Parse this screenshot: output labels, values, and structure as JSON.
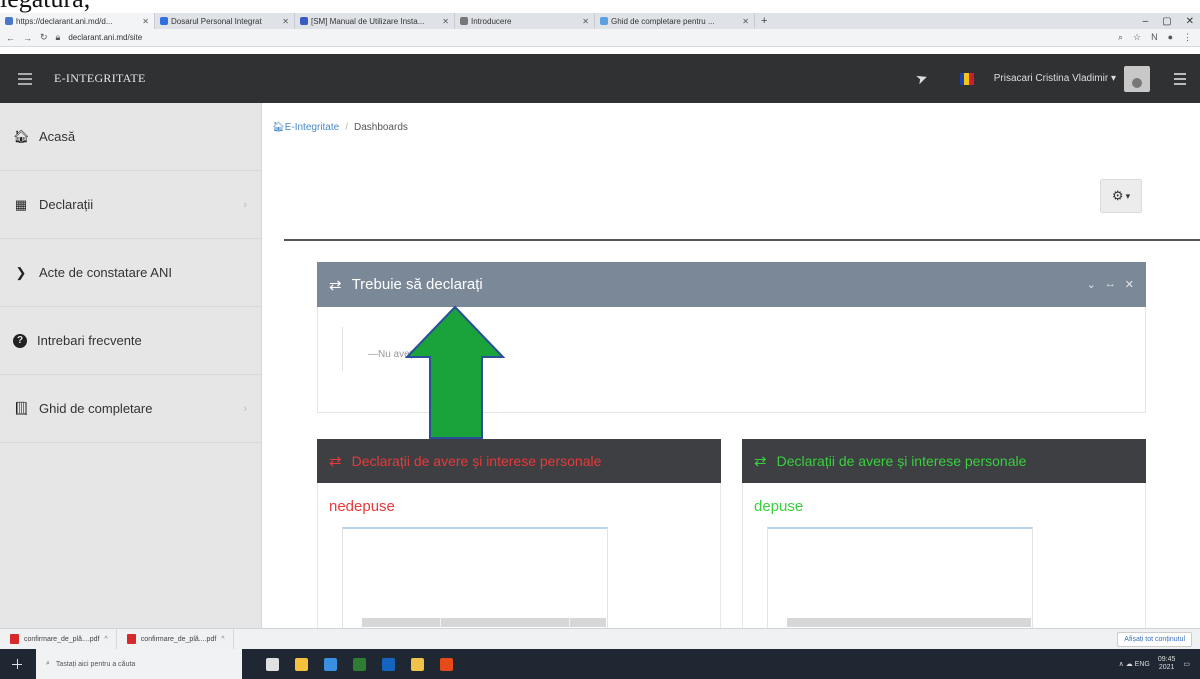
{
  "scan_text": "legătură,",
  "browser": {
    "tabs": [
      {
        "label": "https://declarant.ani.md/d...",
        "color": "#4a78c8",
        "active": true
      },
      {
        "label": "Dosarul Personal Integrat",
        "color": "#2f6fe0",
        "active": false
      },
      {
        "label": "[SM] Manual de Utilizare Insta...",
        "color": "#3b5bc0",
        "active": false
      },
      {
        "label": "Introducere",
        "color": "#777777",
        "active": false
      },
      {
        "label": "Ghid de completare pentru ...",
        "color": "#5aa0e0",
        "active": false
      }
    ],
    "new_tab": "+",
    "address": "declarant.ani.md/site",
    "window_controls": [
      "–",
      "▢",
      "✕"
    ]
  },
  "navbar": {
    "brand": "E-INTEGRITATE",
    "user_name": "Prisacari Cristina Vladimir",
    "flag_colors": [
      "#1f3fa8",
      "#f3c617",
      "#cc1e2a"
    ]
  },
  "sidebar": {
    "items": [
      {
        "label": "Acasă",
        "icon": "home-icon",
        "glyph": "⌂",
        "has_chevron": false
      },
      {
        "label": "Declarații",
        "icon": "grid-icon",
        "glyph": "▦",
        "has_chevron": true
      },
      {
        "label": "Acte de constatare ANI",
        "icon": "chevron-right-icon",
        "glyph": "❯",
        "has_chevron": false
      },
      {
        "label": "Intrebari frecvente",
        "icon": "question-icon",
        "glyph": "?",
        "has_chevron": false
      },
      {
        "label": "Ghid de completare",
        "icon": "book-icon",
        "glyph": "■",
        "has_chevron": true
      }
    ]
  },
  "breadcrumb": {
    "home": "E-Integritate",
    "separator": "/",
    "current": "Dashboards"
  },
  "widgets": {
    "pending": {
      "title": "Trebuie să declarați",
      "body_text": "—Nu aveți nimic de declarat/"
    },
    "not_submitted": {
      "title": "Declarații de avere și interese personale",
      "subtitle": "nedepuse",
      "color": "#e83a3a"
    },
    "submitted": {
      "title": "Declarații de avere și interese personale",
      "subtitle": "depuse",
      "color": "#38d13d"
    }
  },
  "annotation": {
    "arrow_color": "#1aa33b",
    "arrow_outline": "#2a4f9a"
  },
  "downloads": {
    "items": [
      "confirmare_de_plă....pdf",
      "confirmare_de_plă....pdf"
    ],
    "show_all": "Afișați tot conținutul"
  },
  "taskbar": {
    "search_placeholder": "Tastați aici pentru a căuta",
    "app_colors": [
      "#e0e0e0",
      "#f6c23e",
      "#3b8fe0",
      "#2e7d32",
      "#1565c0",
      "#f0c24a",
      "#e64a19"
    ],
    "tray_text": "∧ ☁ ENG",
    "time": "09:45",
    "date": "2021"
  }
}
